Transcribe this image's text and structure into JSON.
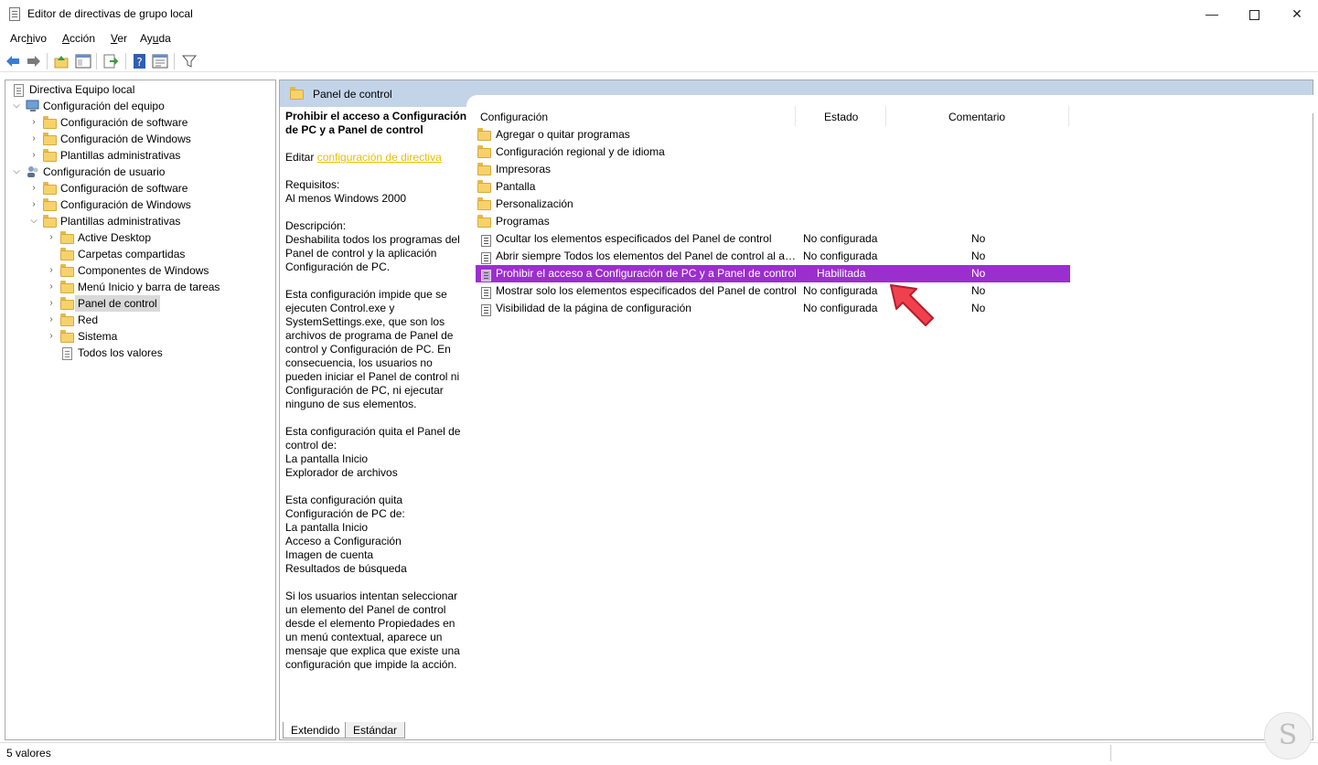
{
  "window": {
    "title": "Editor de directivas de grupo local",
    "minimize_glyph": "—",
    "close_glyph": "✕"
  },
  "menu": {
    "archivo": {
      "first": "Arc",
      "underlined": "h",
      "rest": "ivo"
    },
    "accion": {
      "first": "",
      "underlined": "A",
      "rest": "cción"
    },
    "ver": {
      "first": "",
      "underlined": "V",
      "rest": "er"
    },
    "ayuda": {
      "first": "Ay",
      "underlined": "u",
      "rest": "da"
    }
  },
  "toolbar": {
    "buttons": [
      "back-icon",
      "forward-icon",
      "up-folder-icon",
      "show-hide-tree-icon",
      "export-list-icon",
      "help-icon",
      "properties-icon",
      "filter-icon"
    ]
  },
  "tree": {
    "items": [
      {
        "label": "Directiva Equipo local"
      },
      {
        "label": "Configuración del equipo"
      },
      {
        "label": "Configuración de software"
      },
      {
        "label": "Configuración de Windows"
      },
      {
        "label": "Plantillas administrativas"
      },
      {
        "label": "Configuración de usuario"
      },
      {
        "label": "Configuración de software"
      },
      {
        "label": "Configuración de Windows"
      },
      {
        "label": "Plantillas administrativas"
      },
      {
        "label": "Active Desktop"
      },
      {
        "label": "Carpetas compartidas"
      },
      {
        "label": "Componentes de Windows"
      },
      {
        "label": "Menú Inicio y barra de tareas"
      },
      {
        "label": "Panel de control"
      },
      {
        "label": "Red"
      },
      {
        "label": "Sistema"
      },
      {
        "label": "Todos los valores"
      }
    ]
  },
  "pane": {
    "header_title": "Panel de control"
  },
  "description": {
    "title": "Prohibir el acceso a Configuración de PC y a Panel de control",
    "edit_prefix": "Editar ",
    "edit_link": "configuración de directiva",
    "requirements": "Requisitos:\nAl menos Windows 2000",
    "description": "Descripción:\nDeshabilita todos los programas del Panel de control y la aplicación Configuración de PC.",
    "para1": "Esta configuración impide que se ejecuten Control.exe y SystemSettings.exe, que son los archivos de programa de Panel de control y Configuración de PC. En consecuencia, los usuarios no pueden iniciar el Panel de control ni Configuración de PC, ni ejecutar ninguno de sus elementos.",
    "para2": "Esta configuración quita el Panel de control de:\nLa pantalla Inicio\nExplorador de archivos",
    "para3": "Esta configuración quita Configuración de PC de:\nLa pantalla Inicio\nAcceso a Configuración\nImagen de cuenta\nResultados de búsqueda",
    "para4": "Si los usuarios intentan seleccionar un elemento del Panel de control desde el elemento Propiedades en un menú contextual, aparece un mensaje que explica que existe una configuración que impide la acción."
  },
  "list": {
    "columns": {
      "setting": "Configuración",
      "state": "Estado",
      "comment": "Comentario"
    },
    "folders": [
      "Agregar o quitar programas",
      "Configuración regional y de idioma",
      "Impresoras",
      "Pantalla",
      "Personalización",
      "Programas"
    ],
    "settings": [
      {
        "name": "Ocultar los elementos especificados del Panel de control",
        "state": "No configurada",
        "comment": "No"
      },
      {
        "name": "Abrir siempre Todos los elementos del Panel de control al ab...",
        "state": "No configurada",
        "comment": "No"
      },
      {
        "name": "Prohibir el acceso a Configuración de PC y a Panel de control",
        "state": "Habilitada",
        "comment": "No"
      },
      {
        "name": "Mostrar solo los elementos especificados del Panel de control",
        "state": "No configurada",
        "comment": "No"
      },
      {
        "name": "Visibilidad de la página de configuración",
        "state": "No configurada",
        "comment": "No"
      }
    ],
    "selected_color": "#9b2fcd"
  },
  "tabs": {
    "extended": "Extendido",
    "standard": "Estándar"
  },
  "status": {
    "text": "5 valores"
  },
  "annotation": {
    "arrow_color": "#f0404e"
  },
  "watermark": {
    "glyph": "S"
  }
}
